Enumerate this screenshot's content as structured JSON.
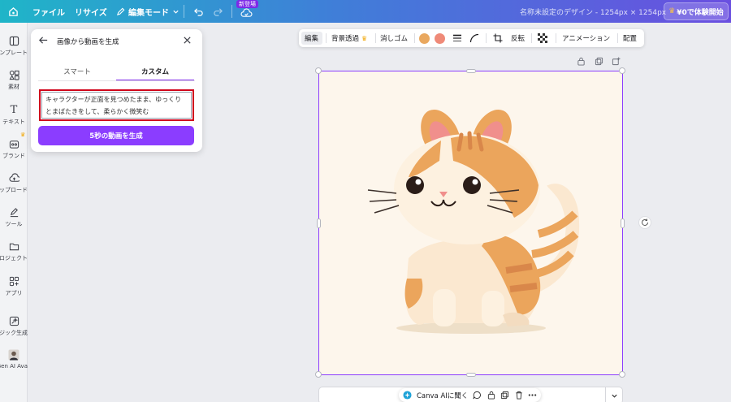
{
  "topbar": {
    "file": "ファイル",
    "resize": "リサイズ",
    "edit_mode": "編集モード",
    "new_badge": "新登場",
    "doc_title": "名称未設定のデザイン - 1254px × 1254px",
    "trial": "¥0で体験開始"
  },
  "rail": [
    {
      "label": "テンプレート",
      "icon": "template-icon"
    },
    {
      "label": "素材",
      "icon": "elements-icon"
    },
    {
      "label": "テキスト",
      "icon": "text-icon"
    },
    {
      "label": "ブランド",
      "icon": "brand-icon"
    },
    {
      "label": "アップロード",
      "icon": "upload-icon"
    },
    {
      "label": "ツール",
      "icon": "draw-icon"
    },
    {
      "label": "プロジェクト",
      "icon": "folder-icon"
    },
    {
      "label": "アプリ",
      "icon": "apps-icon"
    },
    {
      "label": "マジック生成",
      "icon": "magic-icon"
    },
    {
      "label": "HeyGen AI Ava...",
      "icon": "avatar-icon"
    }
  ],
  "panel": {
    "title": "画像から動画を生成",
    "tab_smart": "スマート",
    "tab_custom": "カスタム",
    "prompt_line1": "キャラクターが正面を見つめたまま、ゆっくり",
    "prompt_line2": "とまばたきをして、柔らかく微笑む",
    "generate": "5秒の動画を生成"
  },
  "ctx_toolbar": {
    "edit": "編集",
    "remove_bg": "背景透過",
    "eraser": "消しゴム",
    "flip": "反転",
    "animation": "アニメーション",
    "arrange": "配置",
    "colors": [
      "#e9a85f",
      "#ef8a78"
    ]
  },
  "bottom": {
    "canva_ai": "Canva AIに聞く"
  },
  "colors": {
    "accent": "#8b3dff",
    "prompt_border": "#d0021b"
  }
}
